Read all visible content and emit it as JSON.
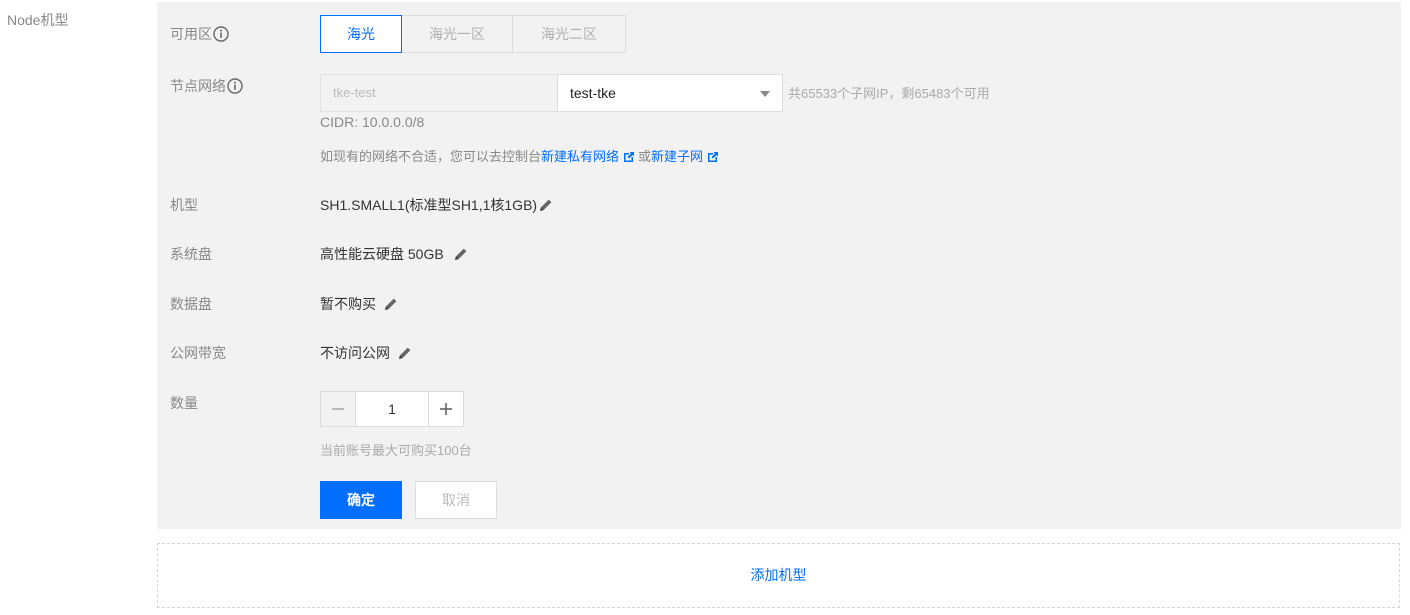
{
  "node_type_label": "Node机型",
  "zone": {
    "label": "可用区",
    "options": [
      "海光",
      "海光一区",
      "海光二区"
    ],
    "selected": "海光"
  },
  "network": {
    "label": "节点网络",
    "vpc_value": "tke-test",
    "subnet_value": "test-tke",
    "subnet_note": "共65533个子网IP，剩65483个可用",
    "cidr": "CIDR: 10.0.0.0/8",
    "hint_prefix": "如现有的网络不合适，您可以去控制台",
    "hint_link_vpc": "新建私有网络",
    "hint_or": "或",
    "hint_link_subnet": "新建子网"
  },
  "machine": {
    "label": "机型",
    "value": "SH1.SMALL1(标准型SH1,1核1GB)"
  },
  "system_disk": {
    "label": "系统盘",
    "value": "高性能云硬盘 50GB"
  },
  "data_disk": {
    "label": "数据盘",
    "value": "暂不购买"
  },
  "bandwidth": {
    "label": "公网带宽",
    "value": "不访问公网"
  },
  "quantity": {
    "label": "数量",
    "value": "1",
    "limit_note": "当前账号最大可购买100台"
  },
  "actions": {
    "confirm": "确定",
    "cancel": "取消"
  },
  "add_type": "添加机型",
  "colors": {
    "accent": "#006eff",
    "panel_bg": "#f2f2f2"
  },
  "icons": [
    "info-icon",
    "external-link-icon",
    "pencil-icon",
    "minus-icon",
    "plus-icon",
    "caret-down-icon"
  ]
}
